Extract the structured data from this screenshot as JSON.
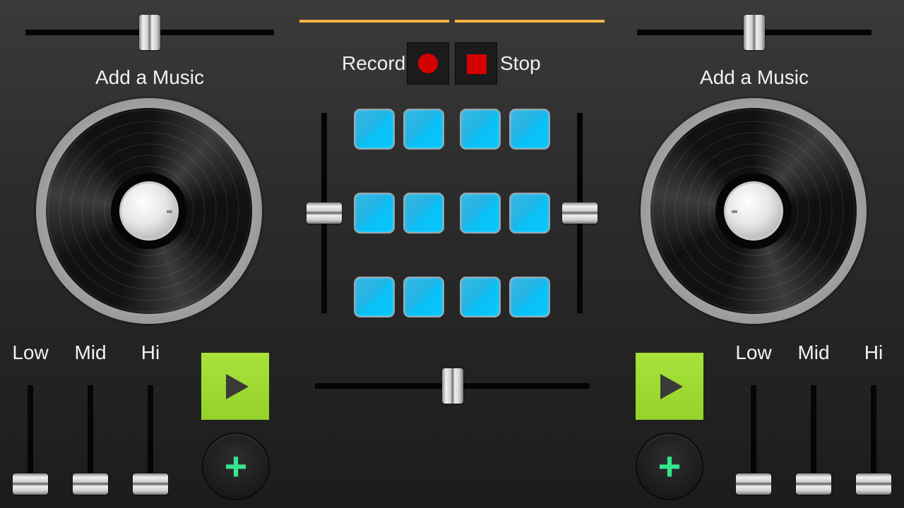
{
  "decks": [
    {
      "id": "left",
      "title": "Add a Music",
      "volume": 0.5
    },
    {
      "id": "right",
      "title": "Add a Music",
      "volume": 0.5
    }
  ],
  "recorder": {
    "record_label": "Record",
    "stop_label": "Stop"
  },
  "eq": {
    "left": [
      {
        "label": "Low",
        "level": 0
      },
      {
        "label": "Mid",
        "level": 0
      },
      {
        "label": "Hi",
        "level": 0
      }
    ],
    "right": [
      {
        "label": "Low",
        "level": 0
      },
      {
        "label": "Mid",
        "level": 0
      },
      {
        "label": "Hi",
        "level": 0
      }
    ]
  },
  "pads": {
    "rows": 3,
    "cols": 4
  },
  "pitch": {
    "left": 0.5,
    "right": 0.5
  },
  "crossfader": 0.5,
  "colors": {
    "pad": "#0ac0f6",
    "play": "#a8e23b",
    "add_plus": "#37e58c",
    "record": "#d50000",
    "accent_line": "#f5b445"
  },
  "icons": {
    "play": "play-icon",
    "add": "plus-icon",
    "record": "record-icon",
    "stop": "stop-icon"
  }
}
